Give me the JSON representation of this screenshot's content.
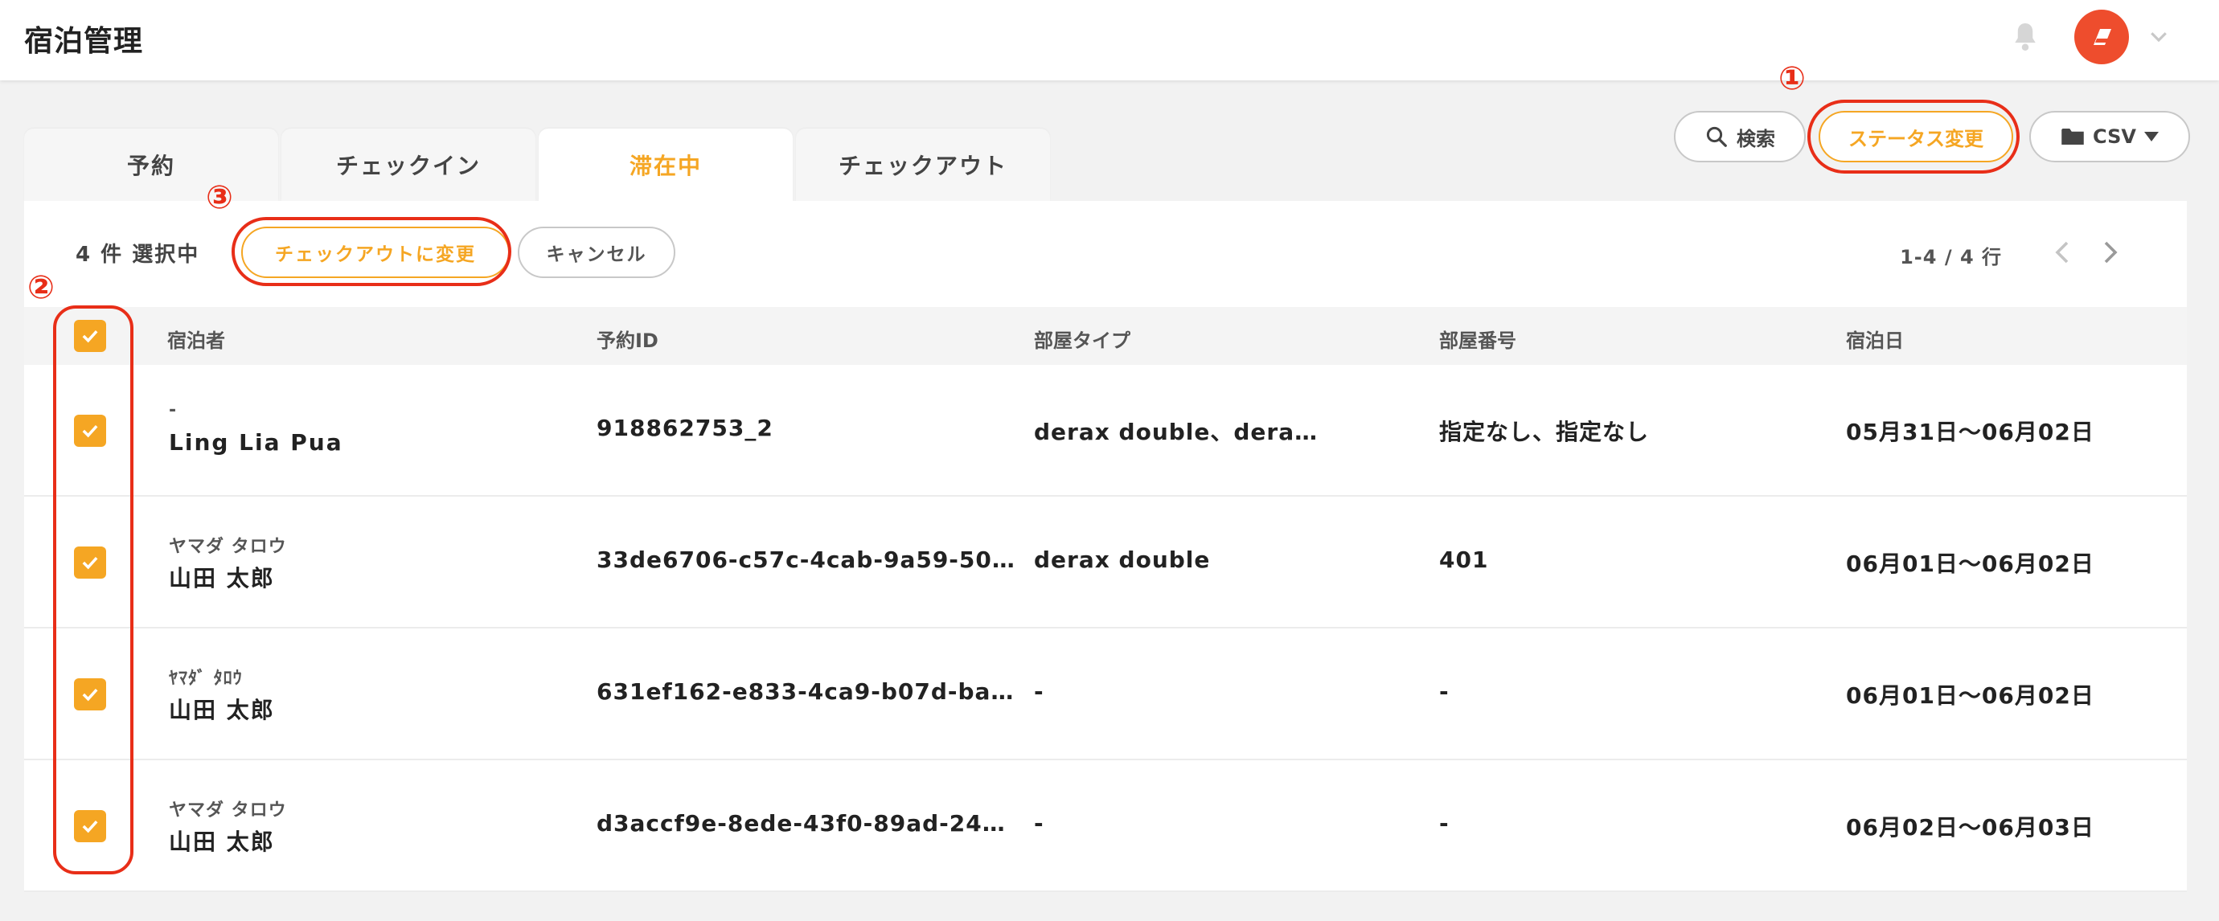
{
  "header": {
    "title": "宿泊管理"
  },
  "tabs": [
    {
      "label": "予約"
    },
    {
      "label": "チェックイン"
    },
    {
      "label": "滞在中"
    },
    {
      "label": "チェックアウト"
    }
  ],
  "actions": {
    "search_label": "検索",
    "status_label": "ステータス変更",
    "csv_label": "CSV"
  },
  "annotations": {
    "one": "①",
    "two": "②",
    "three": "③"
  },
  "toolbar": {
    "selection_text": "4 件 選択中",
    "checkout_label": "チェックアウトに変更",
    "cancel_label": "キャンセル",
    "pagination": "1-4 / 4 行"
  },
  "table": {
    "columns": [
      "宿泊者",
      "予約ID",
      "部屋タイプ",
      "部屋番号",
      "宿泊日"
    ],
    "rows": [
      {
        "kana": "-",
        "name": "Ling Lia Pua",
        "reservation_id": "918862753_2",
        "room_type": "derax double、dera…",
        "room_number": "指定なし、指定なし",
        "dates": "05月31日〜06月02日"
      },
      {
        "kana": "ヤマダ タロウ",
        "name": "山田 太郎",
        "reservation_id": "33de6706-c57c-4cab-9a59-50…",
        "room_type": "derax double",
        "room_number": "401",
        "dates": "06月01日〜06月02日"
      },
      {
        "kana": "ﾔﾏﾀﾞ ﾀﾛｳ",
        "name": "山田 太郎",
        "reservation_id": "631ef162-e833-4ca9-b07d-ba…",
        "room_type": "-",
        "room_number": "-",
        "dates": "06月01日〜06月02日"
      },
      {
        "kana": "ヤマダ タロウ",
        "name": "山田 太郎",
        "reservation_id": "d3accf9e-8ede-43f0-89ad-24…",
        "room_type": "-",
        "room_number": "-",
        "dates": "06月02日〜06月03日"
      }
    ]
  },
  "colors": {
    "accent": "#f5a623",
    "annotation": "#e82e18",
    "avatar": "#ee4d2d"
  },
  "icons": [
    "bell-icon",
    "avatar-logo-icon",
    "chevron-down-icon",
    "search-icon",
    "folder-icon",
    "caret-down-icon",
    "chevron-left-icon",
    "chevron-right-icon",
    "check-icon"
  ]
}
